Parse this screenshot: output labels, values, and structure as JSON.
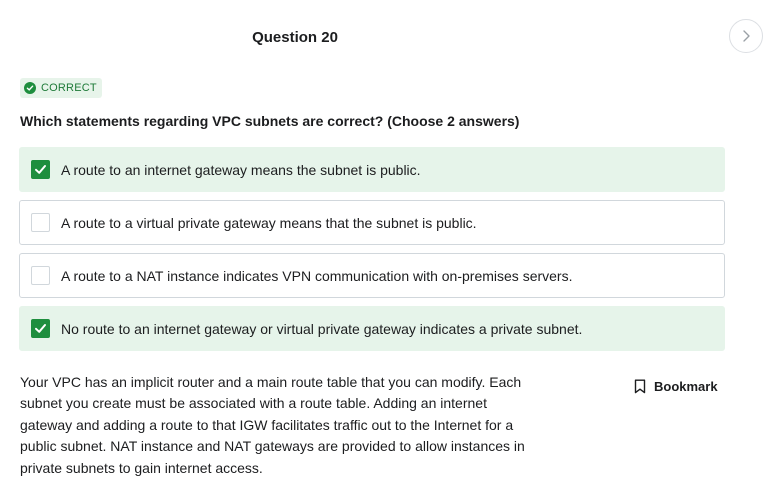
{
  "question": {
    "title": "Question 20",
    "status": "CORRECT",
    "text": "Which statements regarding VPC subnets are correct? (Choose 2 answers)"
  },
  "answers": [
    {
      "label": "A route to an internet gateway means the subnet is public.",
      "selected": true
    },
    {
      "label": "A route to a virtual private gateway means that the subnet is public.",
      "selected": false
    },
    {
      "label": "A route to a NAT instance indicates VPN communication with on-premises servers.",
      "selected": false
    },
    {
      "label": "No route to an internet gateway or virtual private gateway indicates a private subnet.",
      "selected": true
    }
  ],
  "explanation": "Your VPC has an implicit router and a main route table that you can modify. Each subnet you create must be associated with a route table. Adding an internet gateway and adding a route to that IGW facilitates traffic out to the Internet for a public subnet. NAT instance and NAT gateways are provided to allow instances in private subnets to gain internet access.",
  "bookmark": {
    "label": "Bookmark"
  },
  "icons": {
    "next": "chevron-right-icon",
    "status": "check-circle-icon",
    "checkbox": "checkmark-icon",
    "bookmark": "bookmark-icon"
  },
  "colors": {
    "accent": "#1e8e3e",
    "selected_bg": "#e6f4ea",
    "badge_bg": "#e7f4ea",
    "border": "#d1d7dc"
  }
}
